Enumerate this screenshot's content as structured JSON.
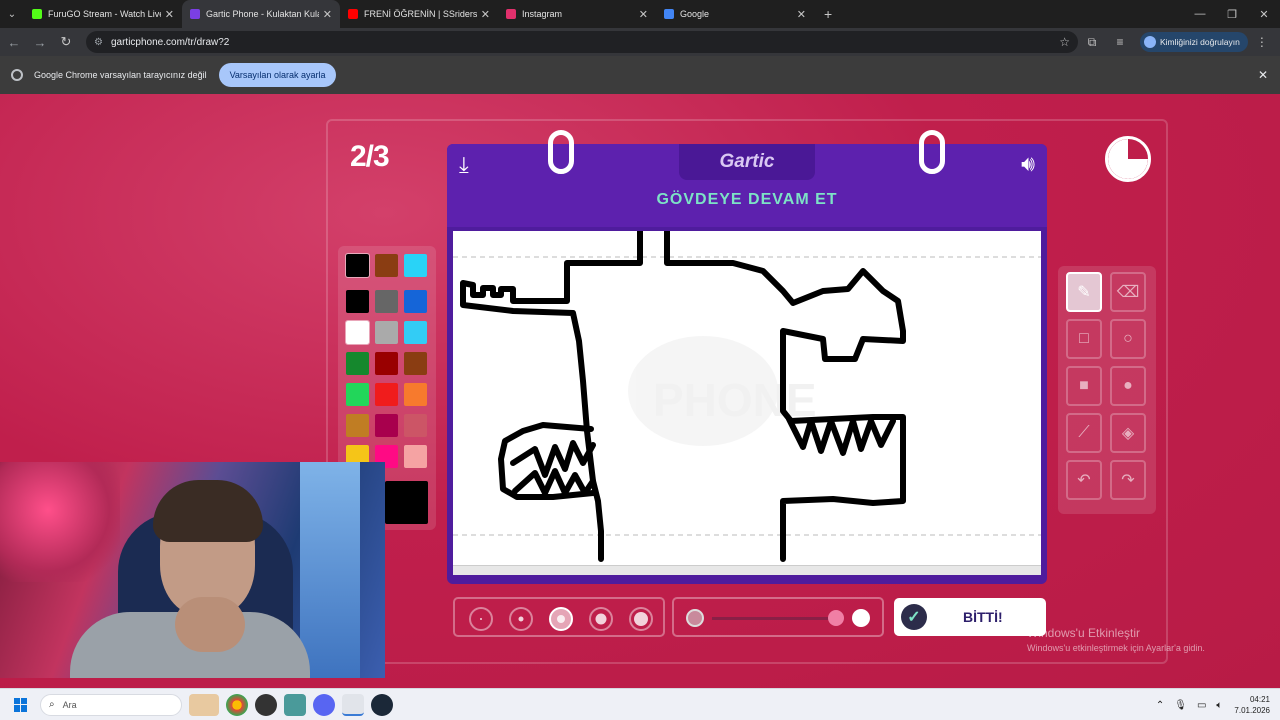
{
  "browser": {
    "tabs": [
      {
        "title": "FuruGO Stream - Watch Live o",
        "favicon": "kick-icon",
        "color": "#53fc18",
        "active": false
      },
      {
        "title": "Gartic Phone - Kulaktan Kulağa",
        "favicon": "gartic-icon",
        "color": "#7b3fe4",
        "active": true
      },
      {
        "title": "FRENİ ÖĞRENİN | SSriders | Mo",
        "favicon": "youtube-icon",
        "color": "#ff0000",
        "active": false
      },
      {
        "title": "Instagram",
        "favicon": "instagram-icon",
        "color": "#e1306c",
        "active": false
      },
      {
        "title": "Google",
        "favicon": "google-icon",
        "color": "#4285f4",
        "active": false
      }
    ],
    "url": "garticphone.com/tr/draw?2",
    "verify_label": "Kimliğinizi doğrulayın",
    "infobar": {
      "message": "Google Chrome varsayılan tarayıcınız değil",
      "button": "Varsayılan olarak ayarla"
    }
  },
  "game": {
    "round": "2/3",
    "logo": "Gartic",
    "prompt": "GÖVDEYE DEVAM ET",
    "done_label": "BİTTİ!",
    "timer_elapsed_fraction": 0.75,
    "palette": [
      [
        "#000000",
        "#8a3d12",
        "#29d3f7"
      ],
      [
        "#000000",
        "#666666",
        "#1565d8"
      ],
      [
        "#ffffff",
        "#aaaaaa",
        "#33ccf5"
      ],
      [
        "#15882d",
        "#990000",
        "#8a3d12"
      ],
      [
        "#22d65a",
        "#f01c1c",
        "#f77a2d"
      ],
      [
        "#c07d23",
        "#a8004d",
        "#cc5566"
      ],
      [
        "#f5c518",
        "#ff0a84",
        "#f5a3a3"
      ]
    ],
    "current_color": "#000000",
    "tools": [
      {
        "name": "pencil-icon",
        "glyph": "✎",
        "selected": true
      },
      {
        "name": "eraser-icon",
        "glyph": "⌫",
        "selected": false
      },
      {
        "name": "rect-outline-icon",
        "glyph": "□",
        "selected": false
      },
      {
        "name": "circle-outline-icon",
        "glyph": "○",
        "selected": false
      },
      {
        "name": "rect-fill-icon",
        "glyph": "■",
        "selected": false
      },
      {
        "name": "circle-fill-icon",
        "glyph": "●",
        "selected": false
      },
      {
        "name": "line-icon",
        "glyph": "⟋",
        "selected": false
      },
      {
        "name": "fill-bucket-icon",
        "glyph": "◈",
        "selected": false
      },
      {
        "name": "undo-icon",
        "glyph": "↶",
        "selected": false
      },
      {
        "name": "redo-icon",
        "glyph": "↷",
        "selected": false
      }
    ],
    "brush_sizes": 5,
    "brush_selected_index": 2,
    "opacity_value": 1.0
  },
  "watermark": {
    "line1": "Windows'u Etkinleştir",
    "line2": "Windows'u etkinleştirmek için Ayarlar'a gidin."
  },
  "taskbar": {
    "search_placeholder": "Ara",
    "time": "04:21",
    "date": "7.01.2026"
  }
}
